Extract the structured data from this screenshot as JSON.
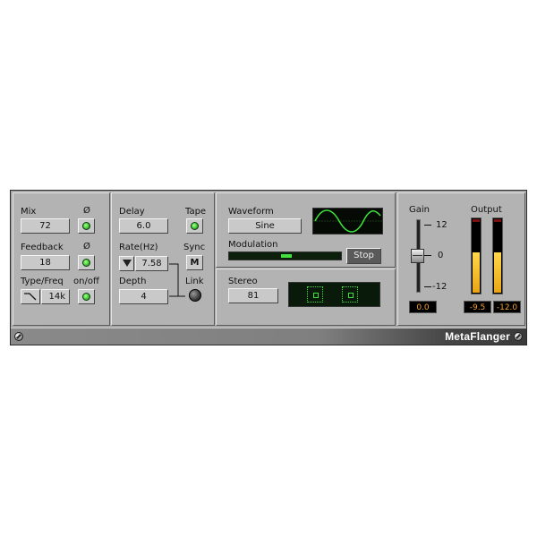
{
  "left_section": {
    "mix": {
      "label": "Mix",
      "value": "72",
      "phase_label": "Ø"
    },
    "feedback": {
      "label": "Feedback",
      "value": "18",
      "phase_label": "Ø"
    },
    "type_freq": {
      "label": "Type/Freq",
      "value": "14k",
      "onoff_label": "on/off"
    }
  },
  "delay_section": {
    "delay": {
      "label": "Delay",
      "value": "6.0"
    },
    "tape": {
      "label": "Tape"
    },
    "rate": {
      "label": "Rate(Hz)",
      "value": "7.58"
    },
    "sync": {
      "label": "Sync",
      "button": "M"
    },
    "depth": {
      "label": "Depth",
      "value": "4"
    },
    "link": {
      "label": "Link"
    }
  },
  "waveform_section": {
    "waveform": {
      "label": "Waveform",
      "value": "Sine"
    },
    "modulation": {
      "label": "Modulation",
      "level": 0.5,
      "stop_label": "Stop"
    }
  },
  "stereo_section": {
    "label": "Stereo",
    "value": "81"
  },
  "gain_section": {
    "label": "Gain",
    "scale": [
      "12",
      "0",
      "-12"
    ],
    "readout": "0.0",
    "level": 0.5
  },
  "output_section": {
    "label": "Output",
    "readouts": [
      "-9.5",
      "-12.0"
    ],
    "levels": [
      0.55,
      0.55
    ]
  },
  "footer": {
    "title": "MetaFlanger"
  },
  "colors": {
    "led": "#47d63b",
    "readout_text": "#f0a330",
    "meter": "#e9a514",
    "panel": "#b3b3b3"
  }
}
